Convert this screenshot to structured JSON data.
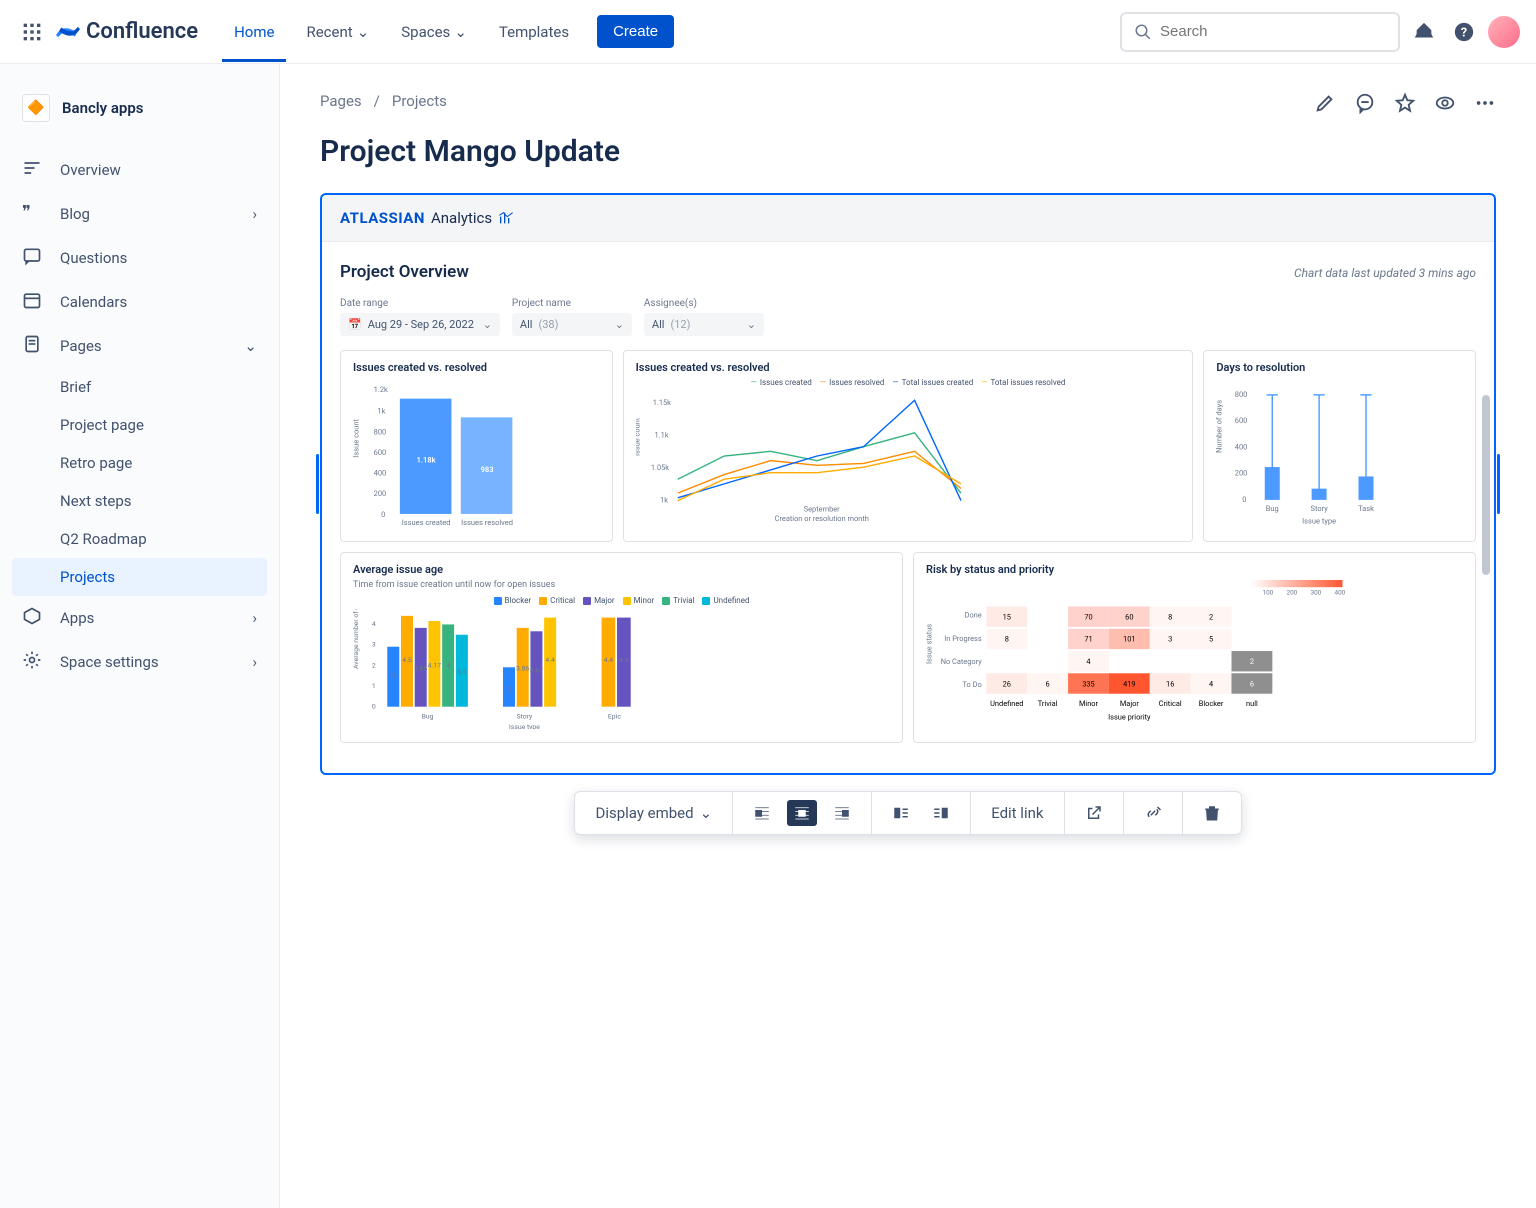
{
  "topbar": {
    "product": "Confluence",
    "nav": {
      "home": "Home",
      "recent": "Recent",
      "spaces": "Spaces",
      "templates": "Templates"
    },
    "create": "Create",
    "search_placeholder": "Search"
  },
  "sidebar": {
    "space_name": "Bancly apps",
    "overview": "Overview",
    "blog": "Blog",
    "questions": "Questions",
    "calendars": "Calendars",
    "pages": "Pages",
    "children": [
      "Brief",
      "Project page",
      "Retro page",
      "Next steps",
      "Q2 Roadmap",
      "Projects"
    ],
    "apps": "Apps",
    "settings": "Space settings"
  },
  "page": {
    "breadcrumb1": "Pages",
    "breadcrumb2": "Projects",
    "title": "Project Mango Update"
  },
  "embed": {
    "brand1": "ATLASSIAN",
    "brand2": "Analytics",
    "overview_title": "Project Overview",
    "updated": "Chart data last updated 3 mins ago",
    "filters": {
      "date_label": "Date range",
      "date_value": "Aug 29 - Sep 26, 2022",
      "project_label": "Project name",
      "project_value": "All",
      "project_count": "(38)",
      "assignee_label": "Assignee(s)",
      "assignee_value": "All",
      "assignee_count": "(12)"
    },
    "chart1_title": "Issues created vs. resolved",
    "chart2_title": "Issues created vs. resolved",
    "chart3_title": "Days to resolution",
    "chart4_title": "Average issue age",
    "chart4_sub": "Time from issue creation until now for open issues",
    "chart5_title": "Risk by status and priority"
  },
  "toolbar": {
    "display": "Display embed",
    "edit": "Edit link"
  },
  "chart_data": [
    {
      "type": "bar",
      "title": "Issues created vs. resolved",
      "ylabel": "Issue count",
      "yticks": [
        0,
        200,
        400,
        600,
        800,
        "1k",
        "1.2k"
      ],
      "categories": [
        "Issues created",
        "Issues resolved"
      ],
      "values": [
        1180,
        983
      ],
      "value_labels": [
        "1.18k",
        "983"
      ]
    },
    {
      "type": "line",
      "title": "Issues created vs. resolved",
      "xlabel": "Creation or resolution month",
      "ylabel": "Issue count",
      "xtick": "September",
      "yticks": [
        "1k",
        "1.05k",
        "1.1k",
        "1.15k"
      ],
      "series": [
        {
          "name": "Issues created",
          "color": "#36B37E"
        },
        {
          "name": "Issues resolved",
          "color": "#FF8B00"
        },
        {
          "name": "Total issues created",
          "color": "#0065FF"
        },
        {
          "name": "Total issues resolved",
          "color": "#FFAB00"
        }
      ]
    },
    {
      "type": "box",
      "title": "Days to resolution",
      "ylabel": "Number of days",
      "xlabel": "Issue type",
      "yticks": [
        0,
        200,
        400,
        600,
        800
      ],
      "categories": [
        "Bug",
        "Story",
        "Task"
      ]
    },
    {
      "type": "bar-grouped",
      "title": "Average issue age",
      "subtitle": "Time from issue creation until now for open issues",
      "ylabel": "Average number of days",
      "xlabel": "Issue type",
      "yticks": [
        0,
        1,
        2,
        3,
        4
      ],
      "categories": [
        "Bug",
        "Story",
        "Epic"
      ],
      "series": [
        {
          "name": "Blocker",
          "color": "#2684FF",
          "values": [
            3,
            2,
            null
          ]
        },
        {
          "name": "Critical",
          "color": "#FFAB00",
          "values": [
            4.5,
            3.86,
            4.4
          ]
        },
        {
          "name": "Major",
          "color": "#6554C0",
          "values": [
            3.86,
            3.67,
            4.4
          ]
        },
        {
          "name": "Minor",
          "color": "#FFC400",
          "values": [
            4.17,
            null,
            null
          ]
        },
        {
          "name": "Trivial",
          "color": "#36B37E",
          "values": [
            4,
            null,
            null
          ]
        },
        {
          "name": "Undefined",
          "color": "#00B8D9",
          "values": [
            3.5,
            null,
            null
          ]
        }
      ],
      "bar_labels_bug": [
        3,
        4.5,
        3.86,
        4.17,
        4,
        3.5
      ],
      "bar_labels_story": [
        2,
        3.86,
        3.67
      ],
      "bar_labels_epic": [
        4.4,
        4.4
      ]
    },
    {
      "type": "heatmap",
      "title": "Risk by status and priority",
      "ylabel": "Issue status",
      "xlabel": "Issue priority",
      "x_categories": [
        "Undefined",
        "Trivial",
        "Minor",
        "Major",
        "Critical",
        "Blocker",
        "null"
      ],
      "y_categories": [
        "Done",
        "In Progress",
        "No Category",
        "To Do"
      ],
      "scale_ticks": [
        100,
        200,
        300,
        400
      ],
      "values": [
        [
          15,
          null,
          70,
          60,
          8,
          2,
          null
        ],
        [
          8,
          null,
          71,
          101,
          3,
          5,
          null
        ],
        [
          null,
          null,
          4,
          null,
          null,
          null,
          null
        ],
        [
          26,
          6,
          335,
          419,
          16,
          4,
          6
        ]
      ]
    }
  ]
}
